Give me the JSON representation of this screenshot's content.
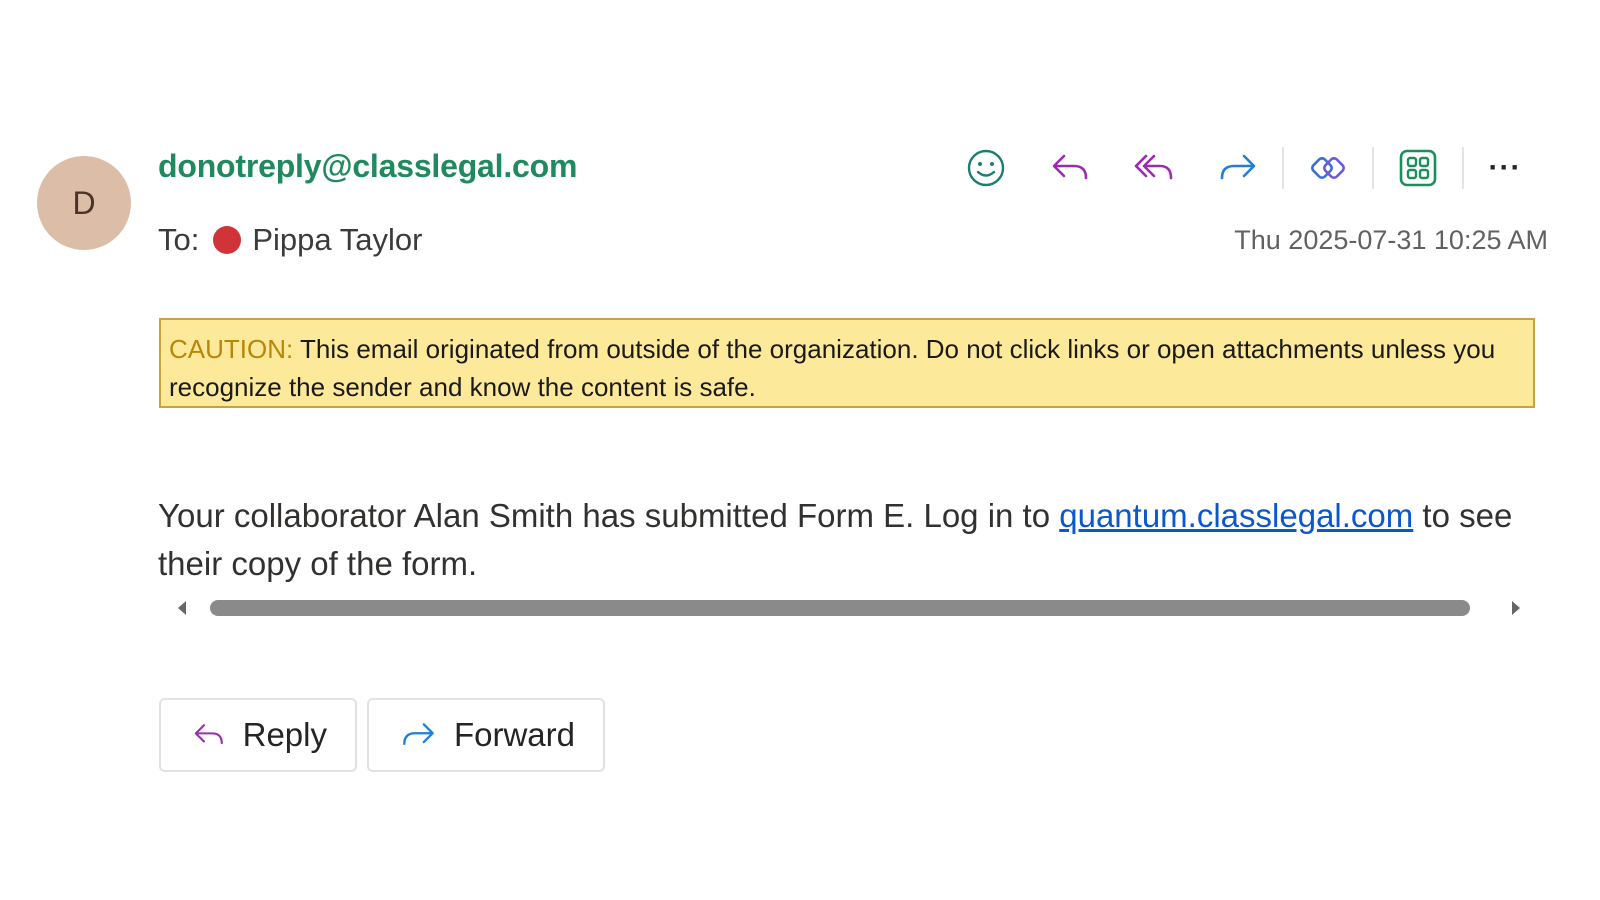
{
  "sender": {
    "avatar_initial": "D",
    "email": "donotreply@classlegal.com"
  },
  "recipients": {
    "to_label": "To:",
    "name": "Pippa Taylor"
  },
  "timestamp": "Thu 2025-07-31 10:25 AM",
  "toolbar": {
    "icons": [
      "emoji-icon",
      "reply-icon",
      "reply-all-icon",
      "forward-icon",
      "loop-icon",
      "apps-icon",
      "more-icon"
    ],
    "more_label": "···"
  },
  "caution": {
    "label": "CAUTION:",
    "text": " This email originated from outside of the organization. Do not click links or open attachments unless you recognize the sender and know the content is safe."
  },
  "body": {
    "before_link": "Your collaborator Alan Smith has submitted Form E. Log in to ",
    "link_text": "quantum.classlegal.com",
    "after_link": " to see their copy of the form."
  },
  "actions": {
    "reply_label": "Reply",
    "forward_label": "Forward"
  },
  "colors": {
    "sender": "#1f8a5f",
    "reply_icon": "#9c2bb0",
    "forward_icon": "#1f7fd6",
    "caution_bg": "#fde99a",
    "caution_label": "#b8860b",
    "presence": "#d13438",
    "link": "#0b57d0"
  }
}
